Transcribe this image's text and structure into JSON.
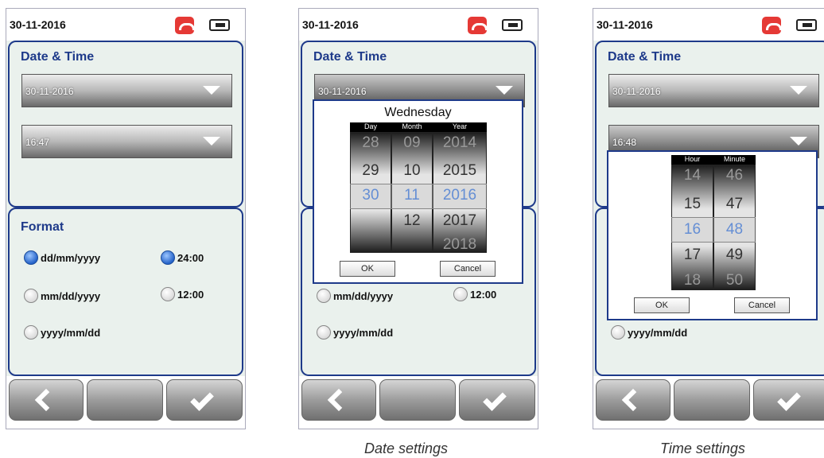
{
  "status": {
    "date": "30-11-2016"
  },
  "screen1": {
    "title": "Date & Time",
    "date_value": "30-11-2016",
    "time_value": "16:47",
    "format_title": "Format",
    "options": {
      "dmy": "dd/mm/yyyy",
      "mdy": "mm/dd/yyyy",
      "ymd": "yyyy/mm/dd",
      "h24": "24:00",
      "h12": "12:00"
    },
    "selected": [
      "dd/mm/yyyy",
      "24:00"
    ]
  },
  "screen2": {
    "title": "Date & Time",
    "date_value": "30-11-2016",
    "picker": {
      "weekday": "Wednesday",
      "headers": [
        "Day",
        "Month",
        "Year"
      ],
      "day": [
        "28",
        "29",
        "30",
        ""
      ],
      "month": [
        "09",
        "10",
        "11",
        "12"
      ],
      "year": [
        "2014",
        "2015",
        "2016",
        "2017",
        "2018"
      ],
      "ok": "OK",
      "cancel": "Cancel"
    },
    "options": {
      "mdy": "mm/dd/yyyy",
      "ymd": "yyyy/mm/dd",
      "h12": "12:00"
    },
    "caption": "Date settings"
  },
  "screen3": {
    "title": "Date & Time",
    "date_value": "30-11-2016",
    "time_value": "16:48",
    "picker": {
      "headers": [
        "Hour",
        "Minute"
      ],
      "hour": [
        "14",
        "15",
        "16",
        "17",
        "18"
      ],
      "minute": [
        "46",
        "47",
        "48",
        "49",
        "50"
      ],
      "ok": "OK",
      "cancel": "Cancel"
    },
    "options": {
      "ymd": "yyyy/mm/dd"
    },
    "caption": "Time settings"
  },
  "colors": {
    "accent": "#1e3a8a",
    "selected_value": "#2f6fdb",
    "call_icon": "#e53935"
  },
  "icons": [
    "hang-up-phone-icon",
    "battery-plug-icon",
    "back-chevron-icon",
    "check-icon",
    "dropdown-caret-icon"
  ]
}
